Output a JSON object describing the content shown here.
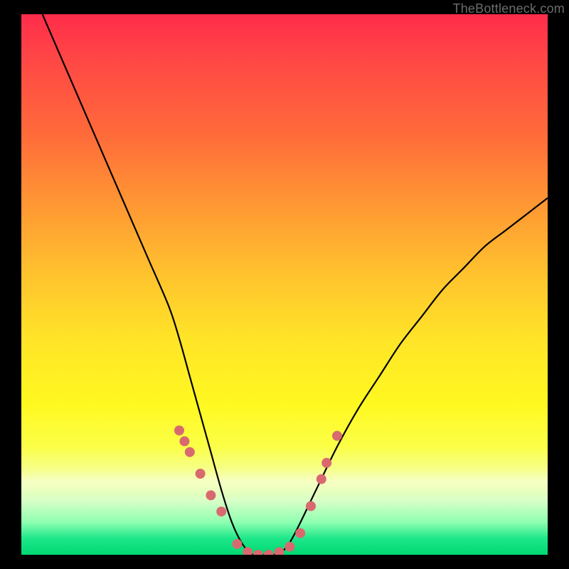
{
  "watermark": "TheBottleneck.com",
  "chart_data": {
    "type": "line",
    "title": "",
    "xlabel": "",
    "ylabel": "",
    "xlim": [
      0,
      100
    ],
    "ylim": [
      0,
      100
    ],
    "series": [
      {
        "name": "bottleneck-curve",
        "x": [
          4,
          8,
          12,
          16,
          20,
          24,
          28,
          30,
          32,
          34,
          36,
          38,
          40,
          42,
          44,
          46,
          48,
          50,
          52,
          56,
          60,
          64,
          68,
          72,
          76,
          80,
          84,
          88,
          92,
          96,
          100
        ],
        "y": [
          100,
          91,
          82,
          73,
          64,
          55,
          46,
          40,
          33,
          26,
          19,
          12,
          6,
          2,
          0,
          0,
          0,
          1,
          4,
          12,
          20,
          27,
          33,
          39,
          44,
          49,
          53,
          57,
          60,
          63,
          66
        ]
      }
    ],
    "markers": {
      "name": "highlight-dots",
      "x": [
        30,
        31,
        32,
        34,
        36,
        38,
        41,
        43,
        45,
        47,
        49,
        51,
        53,
        55,
        57,
        58,
        60
      ],
      "y": [
        23,
        21,
        19,
        15,
        11,
        8,
        2,
        0.5,
        0,
        0,
        0.5,
        1.5,
        4,
        9,
        14,
        17,
        22
      ]
    },
    "gradient_stops": [
      {
        "pos": 0,
        "color": "#ff2c4a"
      },
      {
        "pos": 22,
        "color": "#ff6a3a"
      },
      {
        "pos": 48,
        "color": "#ffc22e"
      },
      {
        "pos": 72,
        "color": "#fff820"
      },
      {
        "pos": 90,
        "color": "#d8ffc8"
      },
      {
        "pos": 100,
        "color": "#00d872"
      }
    ]
  }
}
